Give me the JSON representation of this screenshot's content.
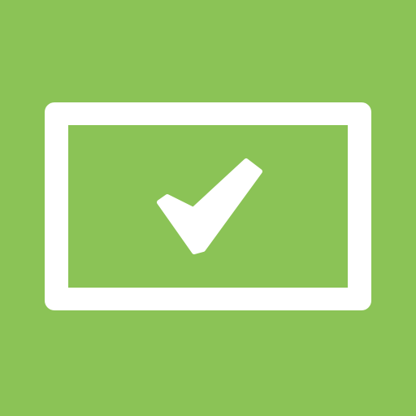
{
  "icon": {
    "name": "checked-card-icon",
    "background_color": "#8bc356",
    "foreground_color": "#ffffff"
  }
}
